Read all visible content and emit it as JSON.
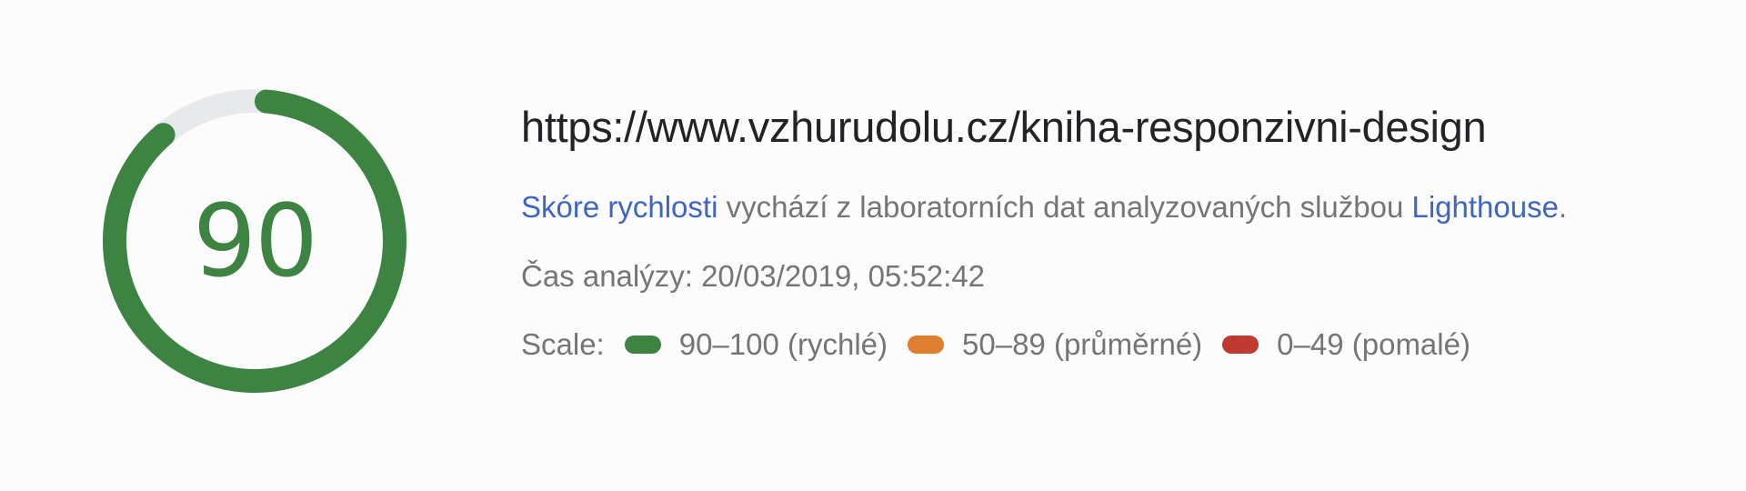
{
  "score": {
    "value": "90",
    "fraction": 0.9,
    "color": "#3d8442",
    "track_color": "#e8e9eb"
  },
  "result": {
    "url": "https://www.vzhurudolu.cz/kniha-responzivni-design",
    "description": {
      "link1": "Skóre rychlosti",
      "middle": " vychází z laboratorních dat analyzovaných službou ",
      "link2": "Lighthouse",
      "end": "."
    },
    "analysis_time": "Čas analýzy: 20/03/2019, 05:52:42"
  },
  "scale": {
    "label": "Scale:",
    "items": [
      {
        "text": "90–100 (rychlé)",
        "color": "#3d8442"
      },
      {
        "text": "50–89 (průměrné)",
        "color": "#dd7f2e"
      },
      {
        "text": "0–49 (pomalé)",
        "color": "#bf3a30"
      }
    ]
  },
  "colors": {
    "link": "#3f65c2",
    "text": "#757575",
    "url": "#222326"
  }
}
